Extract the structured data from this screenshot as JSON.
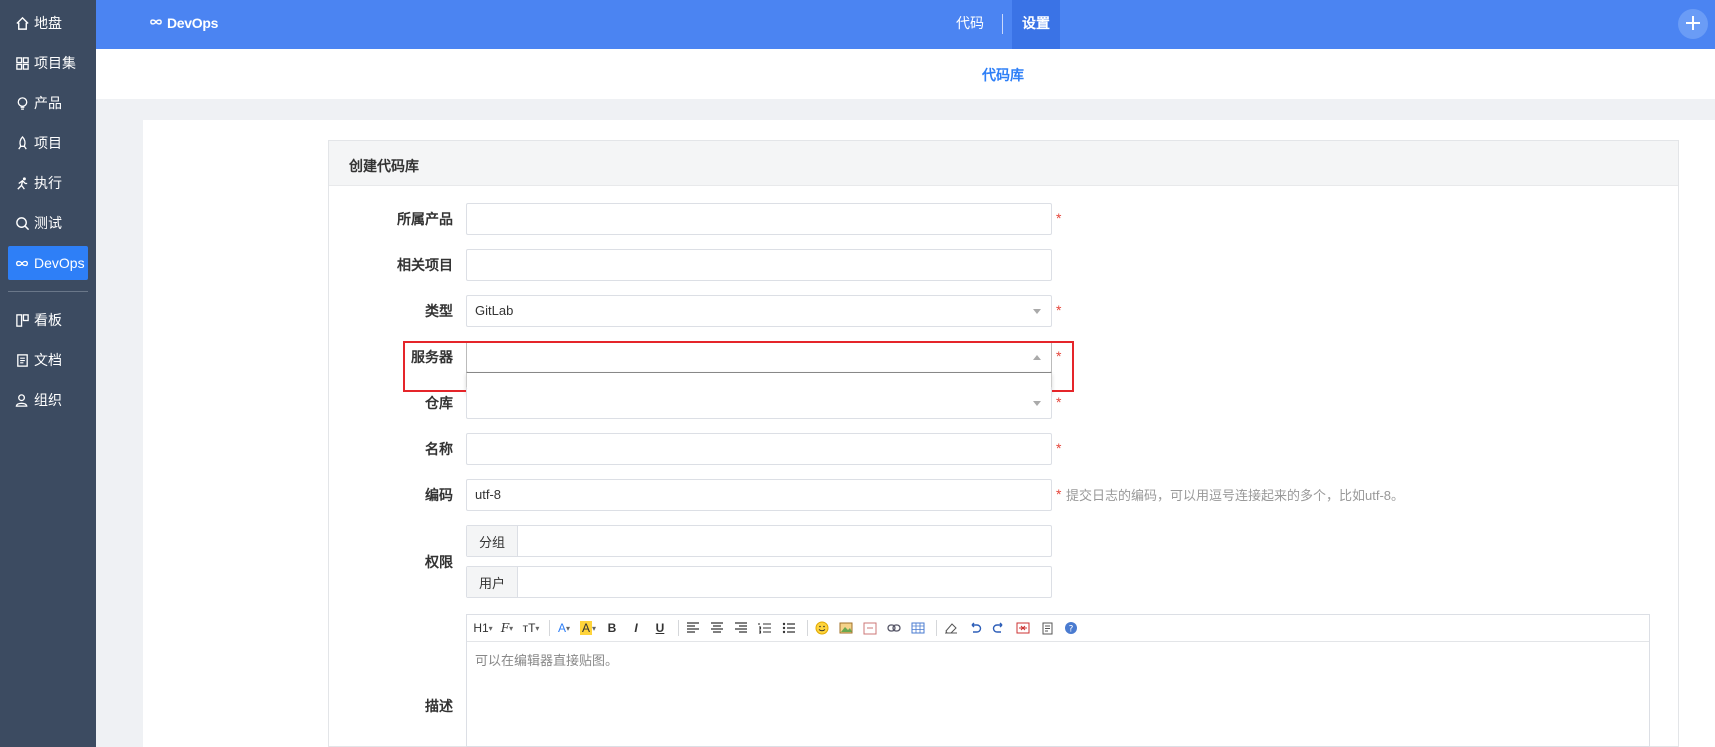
{
  "sidebar": {
    "items": [
      {
        "label": "地盘",
        "icon": "home-icon"
      },
      {
        "label": "项目集",
        "icon": "grid-icon"
      },
      {
        "label": "产品",
        "icon": "lightbulb-icon"
      },
      {
        "label": "项目",
        "icon": "rocket-icon"
      },
      {
        "label": "执行",
        "icon": "run-icon"
      },
      {
        "label": "测试",
        "icon": "bug-search-icon"
      },
      {
        "label": "DevOps",
        "icon": "infinity-icon",
        "active": true
      },
      {
        "label": "看板",
        "icon": "kanban-icon"
      },
      {
        "label": "文档",
        "icon": "book-icon"
      },
      {
        "label": "组织",
        "icon": "users-icon"
      }
    ]
  },
  "topbar": {
    "brand": "DevOps",
    "tabs": [
      {
        "label": "代码"
      },
      {
        "label": "设置",
        "active": true
      }
    ]
  },
  "subnav": {
    "label": "代码库"
  },
  "form": {
    "title": "创建代码库",
    "product": {
      "label": "所属产品",
      "value": ""
    },
    "project": {
      "label": "相关项目",
      "value": ""
    },
    "type": {
      "label": "类型",
      "value": "GitLab"
    },
    "server": {
      "label": "服务器",
      "value": ""
    },
    "repo": {
      "label": "仓库",
      "value": ""
    },
    "name": {
      "label": "名称",
      "value": ""
    },
    "encoding": {
      "label": "编码",
      "value": "utf-8",
      "hint": "提交日志的编码，可以用逗号连接起来的多个，比如utf-8。"
    },
    "acl": {
      "label": "权限",
      "group_addon": "分组",
      "user_addon": "用户"
    },
    "description": {
      "label": "描述",
      "placeholder": "可以在编辑器直接贴图。"
    },
    "required_mark": "*"
  },
  "editor_toolbar": [
    "H1",
    "F",
    "тT",
    "A",
    "A",
    "B",
    "I",
    "U"
  ],
  "colors": {
    "accent": "#2e7ff7",
    "topbar": "#4b84f2",
    "sidebar": "#3c4b61",
    "required": "#e5453a",
    "highlight": "#e5252a"
  }
}
